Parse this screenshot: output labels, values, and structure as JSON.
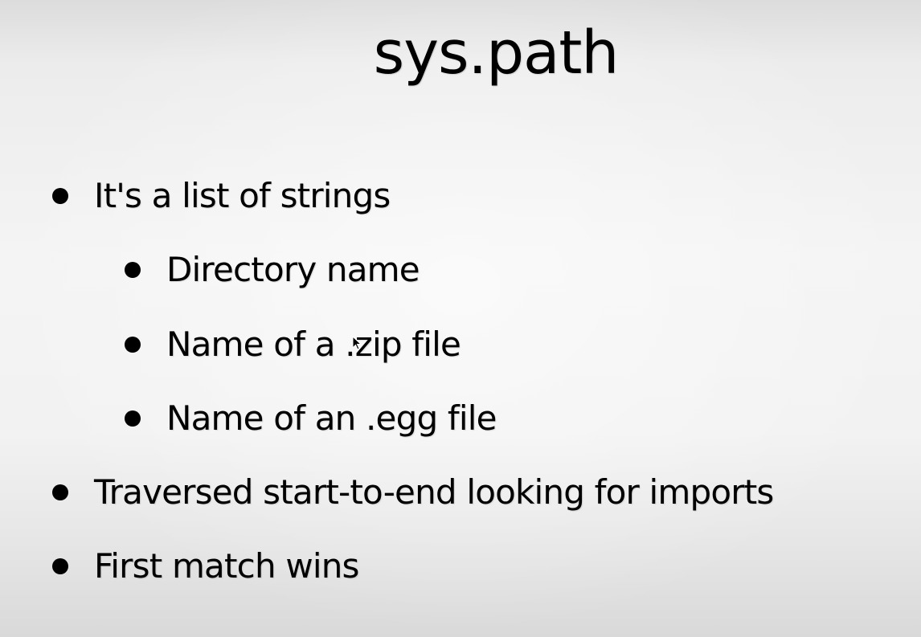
{
  "slide": {
    "title": "sys.path",
    "bullets": [
      {
        "text": "It's a list of strings",
        "children": [
          {
            "text": "Directory name"
          },
          {
            "text": "Name of a .zip file"
          },
          {
            "text": "Name of an .egg file"
          }
        ]
      },
      {
        "text": "Traversed start-to-end looking for imports"
      },
      {
        "text": "First match wins"
      }
    ]
  },
  "colors": {
    "text": "#000000",
    "background": "#f2f2f2"
  },
  "icons": {
    "pointer": "mouse-pointer-icon"
  }
}
